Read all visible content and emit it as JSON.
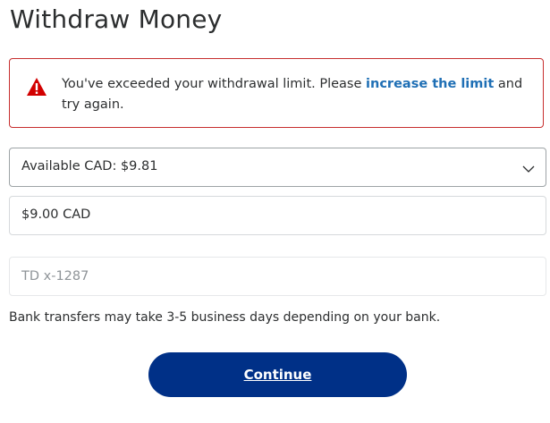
{
  "page": {
    "title": "Withdraw Money"
  },
  "alert": {
    "icon": "warning-triangle-icon",
    "text_before": "You've exceeded your withdrawal limit. Please ",
    "link_text": "increase the limit",
    "text_after": " and try again.",
    "border_color": "#c72e2e",
    "link_color": "#1f6fb5"
  },
  "form": {
    "balance_select": {
      "value": "Available CAD: $9.81",
      "icon": "chevron-down-icon"
    },
    "amount": {
      "value": "$9.00 CAD"
    },
    "bank": {
      "value": "TD x-1287"
    }
  },
  "note": "Bank transfers may take 3-5 business days depending on your bank.",
  "continue_button": {
    "label": "Continue",
    "color": "#003087"
  }
}
